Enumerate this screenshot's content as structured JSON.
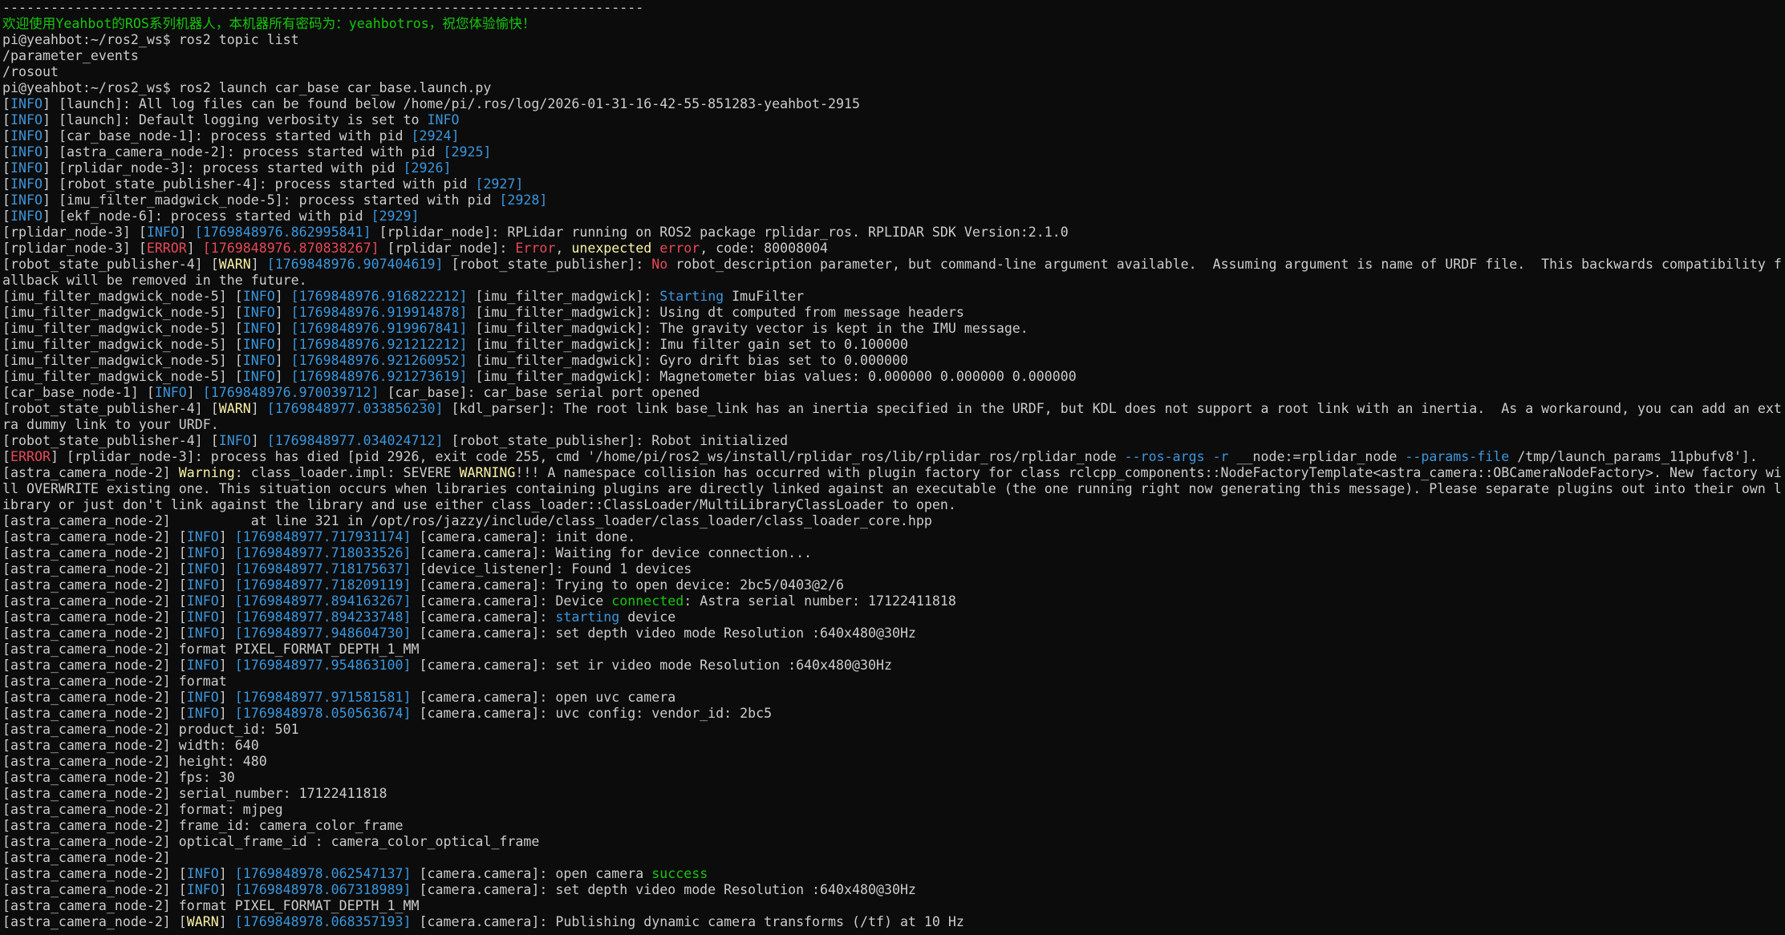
{
  "colors": {
    "background": "#0c0c0c",
    "default": "#cccccc",
    "green": "#16c60c",
    "blue": "#3a96dd",
    "red": "#e74856",
    "yellow": "#f9f1a5"
  },
  "terminal": {
    "lines": [
      [
        [
          "d",
          "--------------------------------------------------------------------------------"
        ]
      ],
      [
        [
          "g",
          "欢迎使用Yeahbot的ROS系列机器人，本机器所有密码为：yeahbotros，祝您体验愉快！"
        ]
      ],
      [
        [
          "d",
          "pi@yeahbot:~/ros2_ws$ ros2 topic list"
        ]
      ],
      [
        [
          "d",
          "/parameter_events"
        ]
      ],
      [
        [
          "d",
          "/rosout"
        ]
      ],
      [
        [
          "d",
          "pi@yeahbot:~/ros2_ws$ ros2 launch car_base car_base.launch.py"
        ]
      ],
      [
        [
          "d",
          "["
        ],
        [
          "b",
          "INFO"
        ],
        [
          "d",
          "] [launch]: All log files can be found below /home/pi/.ros/log/2026-01-31-16-42-55-851283-yeahbot-2915"
        ]
      ],
      [
        [
          "d",
          "["
        ],
        [
          "b",
          "INFO"
        ],
        [
          "d",
          "] [launch]: Default logging verbosity is set to "
        ],
        [
          "b",
          "INFO"
        ]
      ],
      [
        [
          "d",
          "["
        ],
        [
          "b",
          "INFO"
        ],
        [
          "d",
          "] [car_base_node-1]: process started with pid "
        ],
        [
          "b",
          "[2924]"
        ]
      ],
      [
        [
          "d",
          "["
        ],
        [
          "b",
          "INFO"
        ],
        [
          "d",
          "] [astra_camera_node-2]: process started with pid "
        ],
        [
          "b",
          "[2925]"
        ]
      ],
      [
        [
          "d",
          "["
        ],
        [
          "b",
          "INFO"
        ],
        [
          "d",
          "] [rplidar_node-3]: process started with pid "
        ],
        [
          "b",
          "[2926]"
        ]
      ],
      [
        [
          "d",
          "["
        ],
        [
          "b",
          "INFO"
        ],
        [
          "d",
          "] [robot_state_publisher-4]: process started with pid "
        ],
        [
          "b",
          "[2927]"
        ]
      ],
      [
        [
          "d",
          "["
        ],
        [
          "b",
          "INFO"
        ],
        [
          "d",
          "] [imu_filter_madgwick_node-5]: process started with pid "
        ],
        [
          "b",
          "[2928]"
        ]
      ],
      [
        [
          "d",
          "["
        ],
        [
          "b",
          "INFO"
        ],
        [
          "d",
          "] [ekf_node-6]: process started with pid "
        ],
        [
          "b",
          "[2929]"
        ]
      ],
      [
        [
          "d",
          "[rplidar_node-3] ["
        ],
        [
          "b",
          "INFO"
        ],
        [
          "d",
          "] "
        ],
        [
          "b",
          "[1769848976.862995841]"
        ],
        [
          "d",
          " [rplidar_node]: RPLidar running on ROS2 package rplidar_ros. RPLIDAR SDK Version:2.1.0"
        ]
      ],
      [
        [
          "d",
          "[rplidar_node-3] ["
        ],
        [
          "r",
          "ERROR"
        ],
        [
          "d",
          "] "
        ],
        [
          "r",
          "[1769848976.870838267]"
        ],
        [
          "d",
          " [rplidar_node]: "
        ],
        [
          "r",
          "Error"
        ],
        [
          "d",
          ", "
        ],
        [
          "y",
          "unexpected"
        ],
        [
          "d",
          " "
        ],
        [
          "r",
          "error"
        ],
        [
          "d",
          ", code: 80008004"
        ]
      ],
      [
        [
          "d",
          "[robot_state_publisher-4] ["
        ],
        [
          "y",
          "WARN"
        ],
        [
          "d",
          "] "
        ],
        [
          "b",
          "[1769848976.907404619]"
        ],
        [
          "d",
          " [robot_state_publisher]: "
        ],
        [
          "r",
          "No"
        ],
        [
          "d",
          " robot_description parameter, but command-line argument available.  Assuming argument is name of URDF file.  This backwards compatibility f"
        ]
      ],
      [
        [
          "d",
          "allback will be removed in the future."
        ]
      ],
      [
        [
          "d",
          "[imu_filter_madgwick_node-5] ["
        ],
        [
          "b",
          "INFO"
        ],
        [
          "d",
          "] "
        ],
        [
          "b",
          "[1769848976.916822212]"
        ],
        [
          "d",
          " [imu_filter_madgwick]: "
        ],
        [
          "b",
          "Starting"
        ],
        [
          "d",
          " ImuFilter"
        ]
      ],
      [
        [
          "d",
          "[imu_filter_madgwick_node-5] ["
        ],
        [
          "b",
          "INFO"
        ],
        [
          "d",
          "] "
        ],
        [
          "b",
          "[1769848976.919914878]"
        ],
        [
          "d",
          " [imu_filter_madgwick]: Using dt computed from message headers"
        ]
      ],
      [
        [
          "d",
          "[imu_filter_madgwick_node-5] ["
        ],
        [
          "b",
          "INFO"
        ],
        [
          "d",
          "] "
        ],
        [
          "b",
          "[1769848976.919967841]"
        ],
        [
          "d",
          " [imu_filter_madgwick]: The gravity vector is kept in the IMU message."
        ]
      ],
      [
        [
          "d",
          "[imu_filter_madgwick_node-5] ["
        ],
        [
          "b",
          "INFO"
        ],
        [
          "d",
          "] "
        ],
        [
          "b",
          "[1769848976.921212212]"
        ],
        [
          "d",
          " [imu_filter_madgwick]: Imu filter gain set to 0.100000"
        ]
      ],
      [
        [
          "d",
          "[imu_filter_madgwick_node-5] ["
        ],
        [
          "b",
          "INFO"
        ],
        [
          "d",
          "] "
        ],
        [
          "b",
          "[1769848976.921260952]"
        ],
        [
          "d",
          " [imu_filter_madgwick]: Gyro drift bias set to 0.000000"
        ]
      ],
      [
        [
          "d",
          "[imu_filter_madgwick_node-5] ["
        ],
        [
          "b",
          "INFO"
        ],
        [
          "d",
          "] "
        ],
        [
          "b",
          "[1769848976.921273619]"
        ],
        [
          "d",
          " [imu_filter_madgwick]: Magnetometer bias values: 0.000000 0.000000 0.000000"
        ]
      ],
      [
        [
          "d",
          "[car_base_node-1] ["
        ],
        [
          "b",
          "INFO"
        ],
        [
          "d",
          "] "
        ],
        [
          "b",
          "[1769848976.970039712]"
        ],
        [
          "d",
          " [car_base]: car_base serial port opened"
        ]
      ],
      [
        [
          "d",
          "[robot_state_publisher-4] ["
        ],
        [
          "y",
          "WARN"
        ],
        [
          "d",
          "] "
        ],
        [
          "b",
          "[1769848977.033856230]"
        ],
        [
          "d",
          " [kdl_parser]: The root link base_link has an inertia specified in the URDF, but KDL does not support a root link with an inertia.  As a workaround, you can add an ext"
        ]
      ],
      [
        [
          "d",
          "ra dummy link to your URDF."
        ]
      ],
      [
        [
          "d",
          "[robot_state_publisher-4] ["
        ],
        [
          "b",
          "INFO"
        ],
        [
          "d",
          "] "
        ],
        [
          "b",
          "[1769848977.034024712]"
        ],
        [
          "d",
          " [robot_state_publisher]: Robot initialized"
        ]
      ],
      [
        [
          "d",
          "["
        ],
        [
          "r",
          "ERROR"
        ],
        [
          "d",
          "] [rplidar_node-3]: process has died [pid 2926, exit code 255, cmd '/home/pi/ros2_ws/install/rplidar_ros/lib/rplidar_ros/rplidar_node "
        ],
        [
          "b",
          "--ros-args"
        ],
        [
          "d",
          " "
        ],
        [
          "b",
          "-r"
        ],
        [
          "d",
          " __node:=rplidar_node "
        ],
        [
          "b",
          "--params-file"
        ],
        [
          "d",
          " /tmp/launch_params_11pbufv8']."
        ]
      ],
      [
        [
          "d",
          "[astra_camera_node-2] "
        ],
        [
          "y",
          "Warning"
        ],
        [
          "d",
          ": class_loader.impl: SEVERE "
        ],
        [
          "y",
          "WARNING"
        ],
        [
          "d",
          "!!! A namespace collision has occurred with plugin factory for class rclcpp_components::NodeFactoryTemplate<astra_camera::OBCameraNodeFactory>. New factory wi"
        ]
      ],
      [
        [
          "d",
          "ll OVERWRITE existing one. This situation occurs when libraries containing plugins are directly linked against an executable (the one running right now generating this message). Please separate plugins out into their own l"
        ]
      ],
      [
        [
          "d",
          "ibrary or just don't link against the library and use either class_loader::ClassLoader/MultiLibraryClassLoader to open."
        ]
      ],
      [
        [
          "d",
          "[astra_camera_node-2]          at line 321 in /opt/ros/jazzy/include/class_loader/class_loader/class_loader_core.hpp"
        ]
      ],
      [
        [
          "d",
          "[astra_camera_node-2] ["
        ],
        [
          "b",
          "INFO"
        ],
        [
          "d",
          "] "
        ],
        [
          "b",
          "[1769848977.717931174]"
        ],
        [
          "d",
          " [camera.camera]: init done."
        ]
      ],
      [
        [
          "d",
          "[astra_camera_node-2] ["
        ],
        [
          "b",
          "INFO"
        ],
        [
          "d",
          "] "
        ],
        [
          "b",
          "[1769848977.718033526]"
        ],
        [
          "d",
          " [camera.camera]: Waiting for device connection..."
        ]
      ],
      [
        [
          "d",
          "[astra_camera_node-2] ["
        ],
        [
          "b",
          "INFO"
        ],
        [
          "d",
          "] "
        ],
        [
          "b",
          "[1769848977.718175637]"
        ],
        [
          "d",
          " [device_listener]: Found 1 devices"
        ]
      ],
      [
        [
          "d",
          "[astra_camera_node-2] ["
        ],
        [
          "b",
          "INFO"
        ],
        [
          "d",
          "] "
        ],
        [
          "b",
          "[1769848977.718209119]"
        ],
        [
          "d",
          " [camera.camera]: Trying to open device: 2bc5/0403@2/6"
        ]
      ],
      [
        [
          "d",
          "[astra_camera_node-2] ["
        ],
        [
          "b",
          "INFO"
        ],
        [
          "d",
          "] "
        ],
        [
          "b",
          "[1769848977.894163267]"
        ],
        [
          "d",
          " [camera.camera]: Device "
        ],
        [
          "g",
          "connected"
        ],
        [
          "d",
          ": Astra serial number: 17122411818"
        ]
      ],
      [
        [
          "d",
          "[astra_camera_node-2] ["
        ],
        [
          "b",
          "INFO"
        ],
        [
          "d",
          "] "
        ],
        [
          "b",
          "[1769848977.894233748]"
        ],
        [
          "d",
          " [camera.camera]: "
        ],
        [
          "b",
          "starting"
        ],
        [
          "d",
          " device"
        ]
      ],
      [
        [
          "d",
          "[astra_camera_node-2] ["
        ],
        [
          "b",
          "INFO"
        ],
        [
          "d",
          "] "
        ],
        [
          "b",
          "[1769848977.948604730]"
        ],
        [
          "d",
          " [camera.camera]: set depth video mode Resolution :640x480@30Hz"
        ]
      ],
      [
        [
          "d",
          "[astra_camera_node-2] format PIXEL_FORMAT_DEPTH_1_MM"
        ]
      ],
      [
        [
          "d",
          "[astra_camera_node-2] ["
        ],
        [
          "b",
          "INFO"
        ],
        [
          "d",
          "] "
        ],
        [
          "b",
          "[1769848977.954863100]"
        ],
        [
          "d",
          " [camera.camera]: set ir video mode Resolution :640x480@30Hz"
        ]
      ],
      [
        [
          "d",
          "[astra_camera_node-2] format"
        ]
      ],
      [
        [
          "d",
          "[astra_camera_node-2] ["
        ],
        [
          "b",
          "INFO"
        ],
        [
          "d",
          "] "
        ],
        [
          "b",
          "[1769848977.971581581]"
        ],
        [
          "d",
          " [camera.camera]: open uvc camera"
        ]
      ],
      [
        [
          "d",
          "[astra_camera_node-2] ["
        ],
        [
          "b",
          "INFO"
        ],
        [
          "d",
          "] "
        ],
        [
          "b",
          "[1769848978.050563674]"
        ],
        [
          "d",
          " [camera.camera]: uvc config: vendor_id: 2bc5"
        ]
      ],
      [
        [
          "d",
          "[astra_camera_node-2] product_id: 501"
        ]
      ],
      [
        [
          "d",
          "[astra_camera_node-2] width: 640"
        ]
      ],
      [
        [
          "d",
          "[astra_camera_node-2] height: 480"
        ]
      ],
      [
        [
          "d",
          "[astra_camera_node-2] fps: 30"
        ]
      ],
      [
        [
          "d",
          "[astra_camera_node-2] serial_number: 17122411818"
        ]
      ],
      [
        [
          "d",
          "[astra_camera_node-2] format: mjpeg"
        ]
      ],
      [
        [
          "d",
          "[astra_camera_node-2] frame_id: camera_color_frame"
        ]
      ],
      [
        [
          "d",
          "[astra_camera_node-2] optical_frame_id : camera_color_optical_frame"
        ]
      ],
      [
        [
          "d",
          "[astra_camera_node-2]"
        ]
      ],
      [
        [
          "d",
          "[astra_camera_node-2] ["
        ],
        [
          "b",
          "INFO"
        ],
        [
          "d",
          "] "
        ],
        [
          "b",
          "[1769848978.062547137]"
        ],
        [
          "d",
          " [camera.camera]: open camera "
        ],
        [
          "g",
          "success"
        ]
      ],
      [
        [
          "d",
          "[astra_camera_node-2] ["
        ],
        [
          "b",
          "INFO"
        ],
        [
          "d",
          "] "
        ],
        [
          "b",
          "[1769848978.067318989]"
        ],
        [
          "d",
          " [camera.camera]: set depth video mode Resolution :640x480@30Hz"
        ]
      ],
      [
        [
          "d",
          "[astra_camera_node-2] format PIXEL_FORMAT_DEPTH_1_MM"
        ]
      ],
      [
        [
          "d",
          "[astra_camera_node-2] ["
        ],
        [
          "y",
          "WARN"
        ],
        [
          "d",
          "] "
        ],
        [
          "b",
          "[1769848978.068357193]"
        ],
        [
          "d",
          " [camera.camera]: Publishing dynamic camera transforms (/tf) at 10 Hz"
        ]
      ]
    ]
  }
}
